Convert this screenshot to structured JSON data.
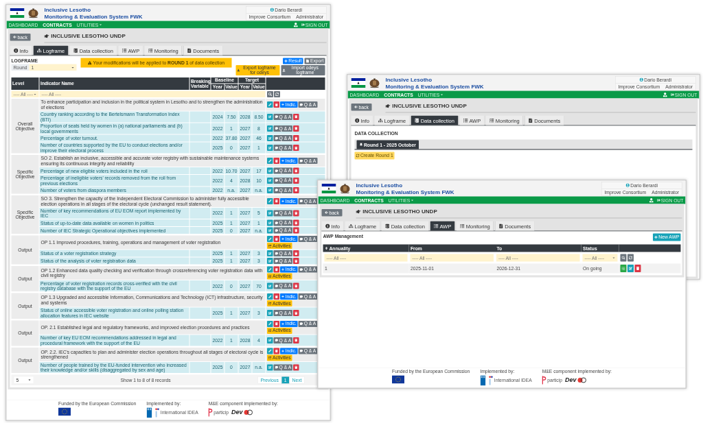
{
  "windows": [
    {
      "kind": "logframe",
      "header": {
        "title_line_1": "Inclusive Lesotho",
        "title_line_2": "Monitoring & Evaluation System FWK",
        "user": "Dario Berardi",
        "organisation": "Improve Consortium",
        "role": "Administrator"
      },
      "nav": {
        "items": [
          {
            "label": "DASHBOARD",
            "selected": false,
            "has_menu": false
          },
          {
            "label": "CONTRACTS",
            "selected": true,
            "has_menu": false
          },
          {
            "label": "UTILITIES",
            "selected": false,
            "has_menu": true
          }
        ],
        "sign_out": "SIGN OUT"
      },
      "back": "back",
      "contract_title": "INCLUSIVE LESOTHO UNDP",
      "tabs": [
        {
          "label": "Info",
          "selected": false
        },
        {
          "label": "Logframe",
          "selected": true
        },
        {
          "label": "Data collection",
          "selected": false
        },
        {
          "label": "AWP",
          "selected": false
        },
        {
          "label": "Monitoring",
          "selected": false
        },
        {
          "label": "Documents",
          "selected": false
        }
      ],
      "logframe": {
        "heading": "LOGFRAME",
        "round_label": "Round",
        "round_value": "1",
        "alert": "Your modifications will be applied to **ROUND 1** of data collection",
        "buttons": [
          {
            "kind": "add",
            "label": "Result"
          },
          {
            "kind": "export",
            "label": "Export"
          },
          {
            "kind": "download",
            "label": "Export logframe for odeys"
          },
          {
            "kind": "upload",
            "label": "Import odeys logframe"
          }
        ],
        "columns": {
          "level": "Level",
          "indicator": "Indicator Name",
          "breaking": "Breaking Variable",
          "baseline": "Baseline",
          "target": "Target",
          "baseline_year": "Year",
          "baseline_value": "Value",
          "target_year": "Year",
          "target_value": "Value"
        },
        "filters": {
          "level": "---- All ----",
          "indicator": "---- All ----"
        },
        "groups": [
          {
            "level": "Overall Objective",
            "statement": "To enhance participation and inclusion in the political system in Lesotho and to strengthen the administration of elections",
            "indic_label": "Indic.",
            "qa_label": "Q & A",
            "indicators": [
              {
                "name": "Country ranking according to the Bertelsmann Transformation Index (BTI)",
                "baseline_year": "2024",
                "baseline_value": "7.50",
                "target_year": "2028",
                "target_value": "8.50",
                "qa_label": "Q & A"
              },
              {
                "name": "Proportion of seats held by women in (a) national parliaments and (b) local governments",
                "baseline_year": "2022",
                "baseline_value": "1",
                "target_year": "2027",
                "target_value": "8",
                "qa_label": "Q & A"
              },
              {
                "name": "Percentage of voter turnout.",
                "baseline_year": "2022",
                "baseline_value": "37.80",
                "target_year": "2027",
                "target_value": "46",
                "qa_label": "Q & A"
              },
              {
                "name": "Number of countries supported by the EU to conduct elections and/or improve their electoral process",
                "baseline_year": "2025",
                "baseline_value": "0",
                "target_year": "2027",
                "target_value": "1",
                "qa_label": "Q & A"
              }
            ]
          },
          {
            "level": "Specific Objective",
            "statement": "SO 2. Establish an inclusive, accessible and accurate voter registry with sustainable maintenance systems ensuring its continuous integrity and reliability",
            "indic_label": "Indic.",
            "qa_label": "Q & A",
            "indicators": [
              {
                "name": "Percentage of new eligible voters included in the roll",
                "baseline_year": "2022",
                "baseline_value": "10.70",
                "target_year": "2027",
                "target_value": "17",
                "qa_label": "Q & A"
              },
              {
                "name": "Percentage of ineligible voters' records removed from the roll from previous elections",
                "baseline_year": "2022",
                "baseline_value": "4",
                "target_year": "2028",
                "target_value": "10",
                "qa_label": "Q & A"
              },
              {
                "name": "Number of voters from diaspora members",
                "baseline_year": "2022",
                "baseline_value": "n.a.",
                "target_year": "2027",
                "target_value": "n.a.",
                "qa_label": "Q & A"
              }
            ]
          },
          {
            "level": "Specific Objective",
            "statement": "SO 3. Strengthen the capacity of the Independent Electoral Commission to administer fully accessible election operations in all stages of the electoral cycle (unchanged result statement).",
            "indic_label": "Indic.",
            "qa_label": "Q & A",
            "indicators": [
              {
                "name": "Number of key recommendations of EU EOM report implemented by IEC",
                "baseline_year": "2022",
                "baseline_value": "1",
                "target_year": "2027",
                "target_value": "5",
                "qa_label": "Q & A"
              },
              {
                "name": "Status of up-to-date data available on women in politics",
                "baseline_year": "2025",
                "baseline_value": "1",
                "target_year": "2027",
                "target_value": "1",
                "qa_label": "Q & A"
              },
              {
                "name": "Number of IEC Strategic Operational objectives implemented",
                "baseline_year": "2025",
                "baseline_value": "0",
                "target_year": "2027",
                "target_value": "n.a.",
                "qa_label": "Q & A"
              }
            ]
          },
          {
            "level": "Output",
            "statement": "OP 1.1 Improved procedures, training, operations and management of voter registration",
            "indic_label": "Indic.",
            "qa_label": "Q & A",
            "activities_label": "Activities",
            "indicators": [
              {
                "name": "Status of a voter registration strategy",
                "baseline_year": "2025",
                "baseline_value": "1",
                "target_year": "2027",
                "target_value": "3",
                "qa_label": "Q & A"
              },
              {
                "name": "Status of the analysis of voter registration data",
                "baseline_year": "2025",
                "baseline_value": "1",
                "target_year": "2027",
                "target_value": "3",
                "qa_label": "Q & A"
              }
            ]
          },
          {
            "level": "Output",
            "statement": "OP 1.2 Enhanced data quality checking and verification through crossreferencing voter registration data with civil registry",
            "indic_label": "Indic.",
            "qa_label": "Q & A",
            "activities_label": "Activities",
            "indicators": [
              {
                "name": "Percentage of voter registration records cross-verified with the civil registry database with the support of the EU",
                "baseline_year": "2022",
                "baseline_value": "0",
                "target_year": "2027",
                "target_value": "70",
                "qa_label": "Q & A"
              }
            ]
          },
          {
            "level": "Output",
            "statement": "OP 1.3 Upgraded and accessible Information, Communications and Technology (ICT) infrastructure, security and systems",
            "indic_label": "Indic.",
            "qa_label": "Q & A",
            "activities_label": "Activities",
            "indicators": [
              {
                "name": "Status of online accessible voter registration and online polling station allocation features in IEC website",
                "baseline_year": "2025",
                "baseline_value": "1",
                "target_year": "2027",
                "target_value": "3",
                "qa_label": "Q & A"
              }
            ]
          },
          {
            "level": "Output",
            "statement": "OP. 2.1 Established legal and regulatory frameworks, and improved election procedures and practices",
            "indic_label": "Indic.",
            "qa_label": "Q & A",
            "activities_label": "Activities",
            "indicators": [
              {
                "name": "Number of key EU EOM recommendations addressed in legal and procedural framework with the support of the EU",
                "baseline_year": "2022",
                "baseline_value": "1",
                "target_year": "2028",
                "target_value": "4",
                "qa_label": "Q & A"
              }
            ]
          },
          {
            "level": "Output",
            "statement": "OP. 2.2. IEC's capacities to plan and administer election operations throughout all stages of electoral cycle is strengthened",
            "indic_label": "Indic.",
            "qa_label": "Q & A",
            "activities_label": "Activities",
            "indicators": [
              {
                "name": "Number of people trained by the EU-funded intervention who increased their knowledge and/or skills (disaggregated by sex and age)",
                "baseline_year": "2025",
                "baseline_value": "0",
                "target_year": "2027",
                "target_value": "n.a.",
                "qa_label": "Q & A"
              }
            ]
          }
        ],
        "pagination": {
          "page_size": "5",
          "summary": "Show 1 to 8 of 8 records",
          "previous": "Previous",
          "pages": [
            {
              "label": "1",
              "selected": true
            }
          ],
          "next": "Next"
        }
      },
      "footer": {
        "groups": [
          {
            "caption": "Funded by the European Commission",
            "logos": [
              {
                "kind": "eu"
              }
            ]
          },
          {
            "caption": "Implemented by:",
            "logos": [
              {
                "kind": "undp"
              },
              {
                "kind": "idea",
                "text": "International IDEA"
              }
            ]
          },
          {
            "caption": "M&E component implemented by:",
            "logos": [
              {
                "kind": "particip",
                "text": "particip"
              },
              {
                "kind": "dev",
                "text": "Dev"
              }
            ]
          }
        ]
      }
    },
    {
      "kind": "data_collection",
      "header": {
        "title_line_1": "Inclusive Lesotho",
        "title_line_2": "Monitoring & Evaluation System FWK",
        "user": "Dario Berardi",
        "organisation": "Improve Consortium",
        "role": "Administrator"
      },
      "nav": {
        "items": [
          {
            "label": "DASHBOARD",
            "selected": false,
            "has_menu": false
          },
          {
            "label": "CONTRACTS",
            "selected": true,
            "has_menu": false
          },
          {
            "label": "UTILITIES",
            "selected": false,
            "has_menu": true
          }
        ],
        "sign_out": "SIGN OUT"
      },
      "back": "back",
      "contract_title": "INCLUSIVE LESOTHO UNDP",
      "tabs": [
        {
          "label": "Info",
          "selected": false
        },
        {
          "label": "Logframe",
          "selected": false
        },
        {
          "label": "Data collection",
          "selected": true
        },
        {
          "label": "AWP",
          "selected": false
        },
        {
          "label": "Monitoring",
          "selected": false
        },
        {
          "label": "Documents",
          "selected": false
        }
      ],
      "data_collection": {
        "heading": "DATA COLLECTION",
        "rounds": [
          {
            "label": "Round 1 - 2025 October",
            "selected": true
          }
        ],
        "create_button": "Create Round 1"
      }
    },
    {
      "kind": "awp",
      "header": {
        "title_line_1": "Inclusive Lesotho",
        "title_line_2": "Monitoring & Evaluation System FWK",
        "user": "Dario Berardi",
        "organisation": "Improve Consortium",
        "role": "Administrator"
      },
      "nav": {
        "items": [
          {
            "label": "DASHBOARD",
            "selected": false,
            "has_menu": false
          },
          {
            "label": "CONTRACTS",
            "selected": true,
            "has_menu": false
          },
          {
            "label": "UTILITIES",
            "selected": false,
            "has_menu": true
          }
        ],
        "sign_out": "SIGN OUT"
      },
      "back": "back",
      "contract_title": "INCLUSIVE LESOTHO UNDP",
      "tabs": [
        {
          "label": "Info",
          "selected": false
        },
        {
          "label": "Logframe",
          "selected": false
        },
        {
          "label": "Data collection",
          "selected": false
        },
        {
          "label": "AWP",
          "selected": true
        },
        {
          "label": "Monitoring",
          "selected": false
        },
        {
          "label": "Documents",
          "selected": false
        }
      ],
      "awp": {
        "heading": "AWP Management",
        "new_button": "New AWP",
        "columns": [
          "Annuality",
          "From",
          "To",
          "Status"
        ],
        "filters": [
          "---- All ----",
          "---- All ----",
          "---- All ----",
          "---- All ----"
        ],
        "rows": [
          {
            "cells": [
              "1",
              "2025-11-01",
              "2026-12-31",
              "On going"
            ]
          }
        ]
      },
      "footer": {
        "groups": [
          {
            "caption": "Funded by the European Commission",
            "logos": [
              {
                "kind": "eu"
              }
            ]
          },
          {
            "caption": "Implemented by:",
            "logos": [
              {
                "kind": "undp"
              },
              {
                "kind": "idea",
                "text": "International IDEA"
              }
            ]
          },
          {
            "caption": "M&E component implemented by:",
            "logos": [
              {
                "kind": "particip",
                "text": "particip"
              },
              {
                "kind": "dev",
                "text": "Dev"
              }
            ]
          }
        ]
      }
    }
  ]
}
